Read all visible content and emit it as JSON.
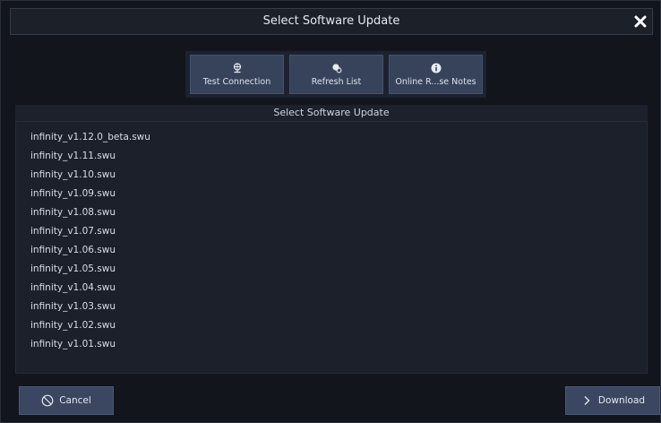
{
  "dialog": {
    "title": "Select Software Update",
    "close_icon": "close-icon"
  },
  "toolbar": {
    "buttons": [
      {
        "label": "Test Connection",
        "icon": "network-icon"
      },
      {
        "label": "Refresh List",
        "icon": "refresh-icon"
      },
      {
        "label": "Online R...se Notes",
        "icon": "info-icon"
      }
    ]
  },
  "list": {
    "header": "Select Software Update",
    "items": [
      "infinity_v1.12.0_beta.swu",
      "infinity_v1.11.swu",
      "infinity_v1.10.swu",
      "infinity_v1.09.swu",
      "infinity_v1.08.swu",
      "infinity_v1.07.swu",
      "infinity_v1.06.swu",
      "infinity_v1.05.swu",
      "infinity_v1.04.swu",
      "infinity_v1.03.swu",
      "infinity_v1.02.swu",
      "infinity_v1.01.swu"
    ]
  },
  "footer": {
    "cancel_label": "Cancel",
    "cancel_icon": "cancel-icon",
    "download_label": "Download",
    "download_icon": "chevron-right-icon"
  },
  "colors": {
    "background": "#12151c",
    "panel": "#1b202a",
    "button": "#3b4760",
    "text": "#d9dde5"
  }
}
